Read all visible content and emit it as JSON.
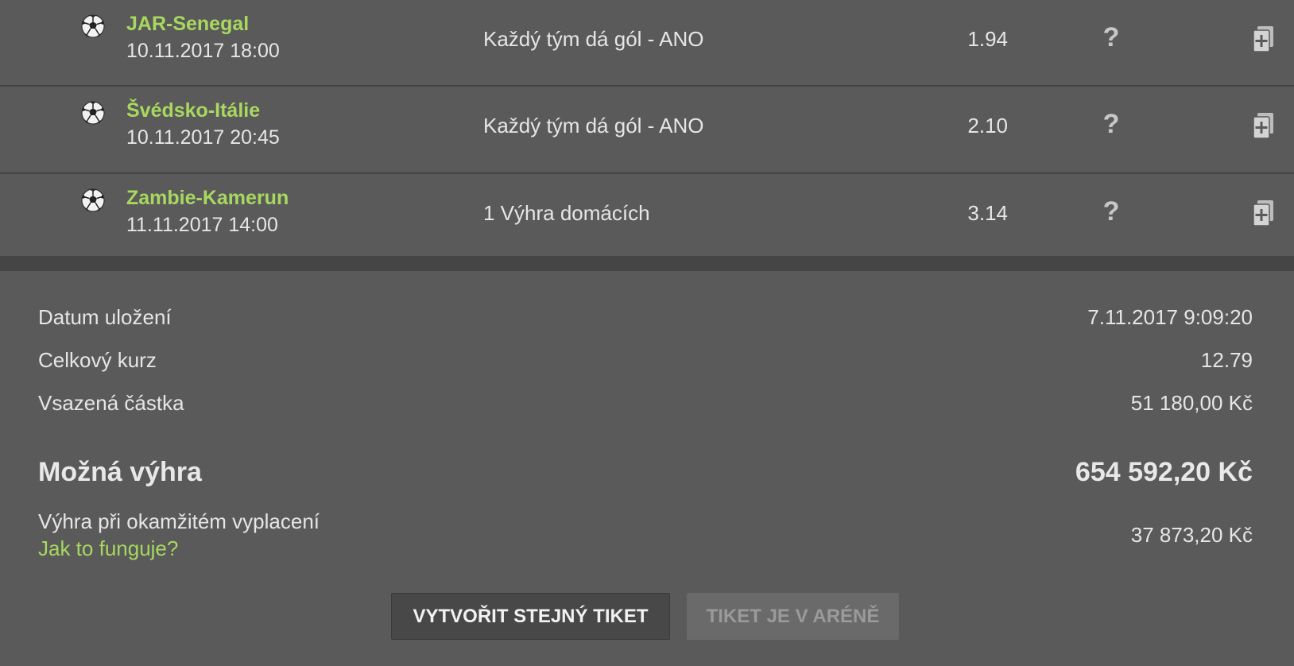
{
  "bets": [
    {
      "match": "JAR-Senegal",
      "datetime": "10.11.2017 18:00",
      "tip": "Každý tým dá gól - ANO",
      "odds": "1.94",
      "help": "?",
      "sport_icon": "soccer-ball-icon"
    },
    {
      "match": "Švédsko-Itálie",
      "datetime": "10.11.2017 20:45",
      "tip": "Každý tým dá gól - ANO",
      "odds": "2.10",
      "help": "?",
      "sport_icon": "soccer-ball-icon"
    },
    {
      "match": "Zambie-Kamerun",
      "datetime": "11.11.2017 14:00",
      "tip": "1 Výhra domácích",
      "odds": "3.14",
      "help": "?",
      "sport_icon": "soccer-ball-icon"
    }
  ],
  "summary": {
    "saved_label": "Datum uložení",
    "saved_value": "7.11.2017 9:09:20",
    "total_odds_label": "Celkový kurz",
    "total_odds_value": "12.79",
    "stake_label": "Vsazená částka",
    "stake_value": "51 180,00 Kč",
    "possible_win_label": "Možná výhra",
    "possible_win_value": "654 592,20 Kč",
    "cashout_label": "Výhra při okamžitém vyplacení",
    "cashout_link": "Jak to funguje?",
    "cashout_value": "37 873,20 Kč"
  },
  "buttons": {
    "create_same": "VYTVOŘIT STEJNÝ TIKET",
    "in_arena": "TIKET JE V ARÉNĚ"
  },
  "colors": {
    "accent_green": "#a8d85f",
    "background": "#5a5a5a",
    "divider": "#454545"
  }
}
